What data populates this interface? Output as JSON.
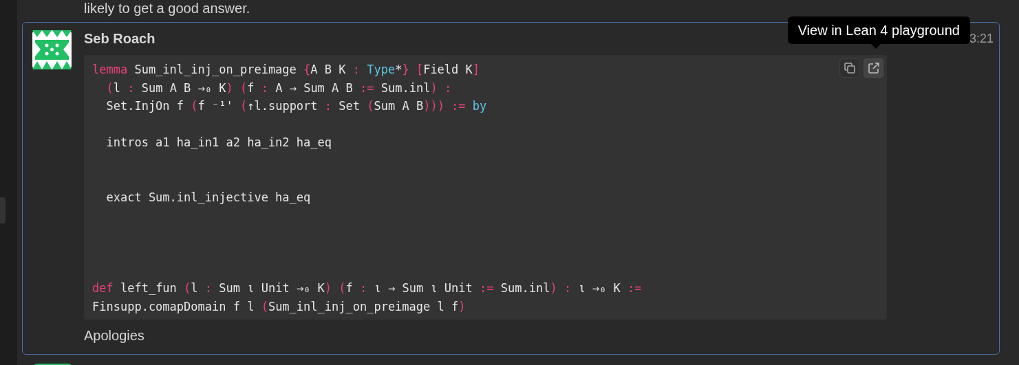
{
  "previous_message": {
    "text": "likely to get a good answer."
  },
  "message": {
    "sender": "Seb Roach",
    "time": "3:21",
    "text": "Apologies",
    "code_lines": [
      {
        "kind": "code",
        "segments": [
          {
            "text": "lemma",
            "color": "#e8407a"
          },
          {
            "text": " Sum_inl_inj_on_preimage ",
            "color": "#e6e6e6"
          },
          {
            "text": "{",
            "color": "#e8407a"
          },
          {
            "text": "A B K ",
            "color": "#e6e6e6"
          },
          {
            "text": ": ",
            "color": "#e8407a"
          },
          {
            "text": "Type",
            "color": "#5fc3e4"
          },
          {
            "text": "*",
            "color": "#e6e6e6"
          },
          {
            "text": "} [",
            "color": "#e8407a"
          },
          {
            "text": "Field K",
            "color": "#e6e6e6"
          },
          {
            "text": "]",
            "color": "#e8407a"
          }
        ]
      },
      {
        "kind": "code",
        "segments": [
          {
            "text": "  (",
            "color": "#e8407a"
          },
          {
            "text": "l ",
            "color": "#e6e6e6"
          },
          {
            "text": ": ",
            "color": "#e8407a"
          },
          {
            "text": "Sum A B →₀ K",
            "color": "#e6e6e6"
          },
          {
            "text": ") (",
            "color": "#e8407a"
          },
          {
            "text": "f ",
            "color": "#e6e6e6"
          },
          {
            "text": ": ",
            "color": "#e8407a"
          },
          {
            "text": "A → Sum A B ",
            "color": "#e6e6e6"
          },
          {
            "text": ":= ",
            "color": "#e8407a"
          },
          {
            "text": "Sum.inl",
            "color": "#e6e6e6"
          },
          {
            "text": ") :",
            "color": "#e8407a"
          }
        ]
      },
      {
        "kind": "code",
        "segments": [
          {
            "text": "  Set.InjOn f ",
            "color": "#e6e6e6"
          },
          {
            "text": "(",
            "color": "#e8407a"
          },
          {
            "text": "f ⁻¹' ",
            "color": "#e6e6e6"
          },
          {
            "text": "(",
            "color": "#e8407a"
          },
          {
            "text": "↑l.support ",
            "color": "#e6e6e6"
          },
          {
            "text": ": ",
            "color": "#e8407a"
          },
          {
            "text": "Set ",
            "color": "#e6e6e6"
          },
          {
            "text": "(",
            "color": "#e8407a"
          },
          {
            "text": "Sum A B",
            "color": "#e6e6e6"
          },
          {
            "text": "))) := ",
            "color": "#e8407a"
          },
          {
            "text": "by",
            "color": "#5fc3e4"
          }
        ]
      },
      {
        "kind": "blank"
      },
      {
        "kind": "code",
        "segments": [
          {
            "text": "  intros a1 ha_in1 a2 ha_in2 ha_eq",
            "color": "#e6e6e6"
          }
        ]
      },
      {
        "kind": "blank"
      },
      {
        "kind": "blank"
      },
      {
        "kind": "code",
        "segments": [
          {
            "text": "  exact Sum.inl_injective ha_eq",
            "color": "#e6e6e6"
          }
        ]
      },
      {
        "kind": "blank"
      },
      {
        "kind": "blank"
      },
      {
        "kind": "blank"
      },
      {
        "kind": "blank"
      },
      {
        "kind": "code",
        "segments": [
          {
            "text": "def ",
            "color": "#e8407a"
          },
          {
            "text": "left_fun ",
            "color": "#e6e6e6"
          },
          {
            "text": "(",
            "color": "#e8407a"
          },
          {
            "text": "l ",
            "color": "#e6e6e6"
          },
          {
            "text": ": ",
            "color": "#e8407a"
          },
          {
            "text": "Sum ι Unit →₀ K",
            "color": "#e6e6e6"
          },
          {
            "text": ") (",
            "color": "#e8407a"
          },
          {
            "text": "f ",
            "color": "#e6e6e6"
          },
          {
            "text": ": ",
            "color": "#e8407a"
          },
          {
            "text": "ι → Sum ι Unit ",
            "color": "#e6e6e6"
          },
          {
            "text": ":= ",
            "color": "#e8407a"
          },
          {
            "text": "Sum.inl",
            "color": "#e6e6e6"
          },
          {
            "text": ") : ",
            "color": "#e8407a"
          },
          {
            "text": "ι →₀ K ",
            "color": "#e6e6e6"
          },
          {
            "text": ":=",
            "color": "#e8407a"
          }
        ]
      },
      {
        "kind": "code",
        "segments": [
          {
            "text": "Finsupp.comapDomain f l ",
            "color": "#e6e6e6"
          },
          {
            "text": "(",
            "color": "#e8407a"
          },
          {
            "text": "Sum_inl_inj_on_preimage l f",
            "color": "#e6e6e6"
          },
          {
            "text": ")",
            "color": "#e8407a"
          }
        ]
      }
    ]
  },
  "code_actions": [
    {
      "kind": "copy",
      "hovered": false
    },
    {
      "kind": "open",
      "hovered": true
    }
  ],
  "tooltip": {
    "text": "View in Lean 4 playground"
  }
}
